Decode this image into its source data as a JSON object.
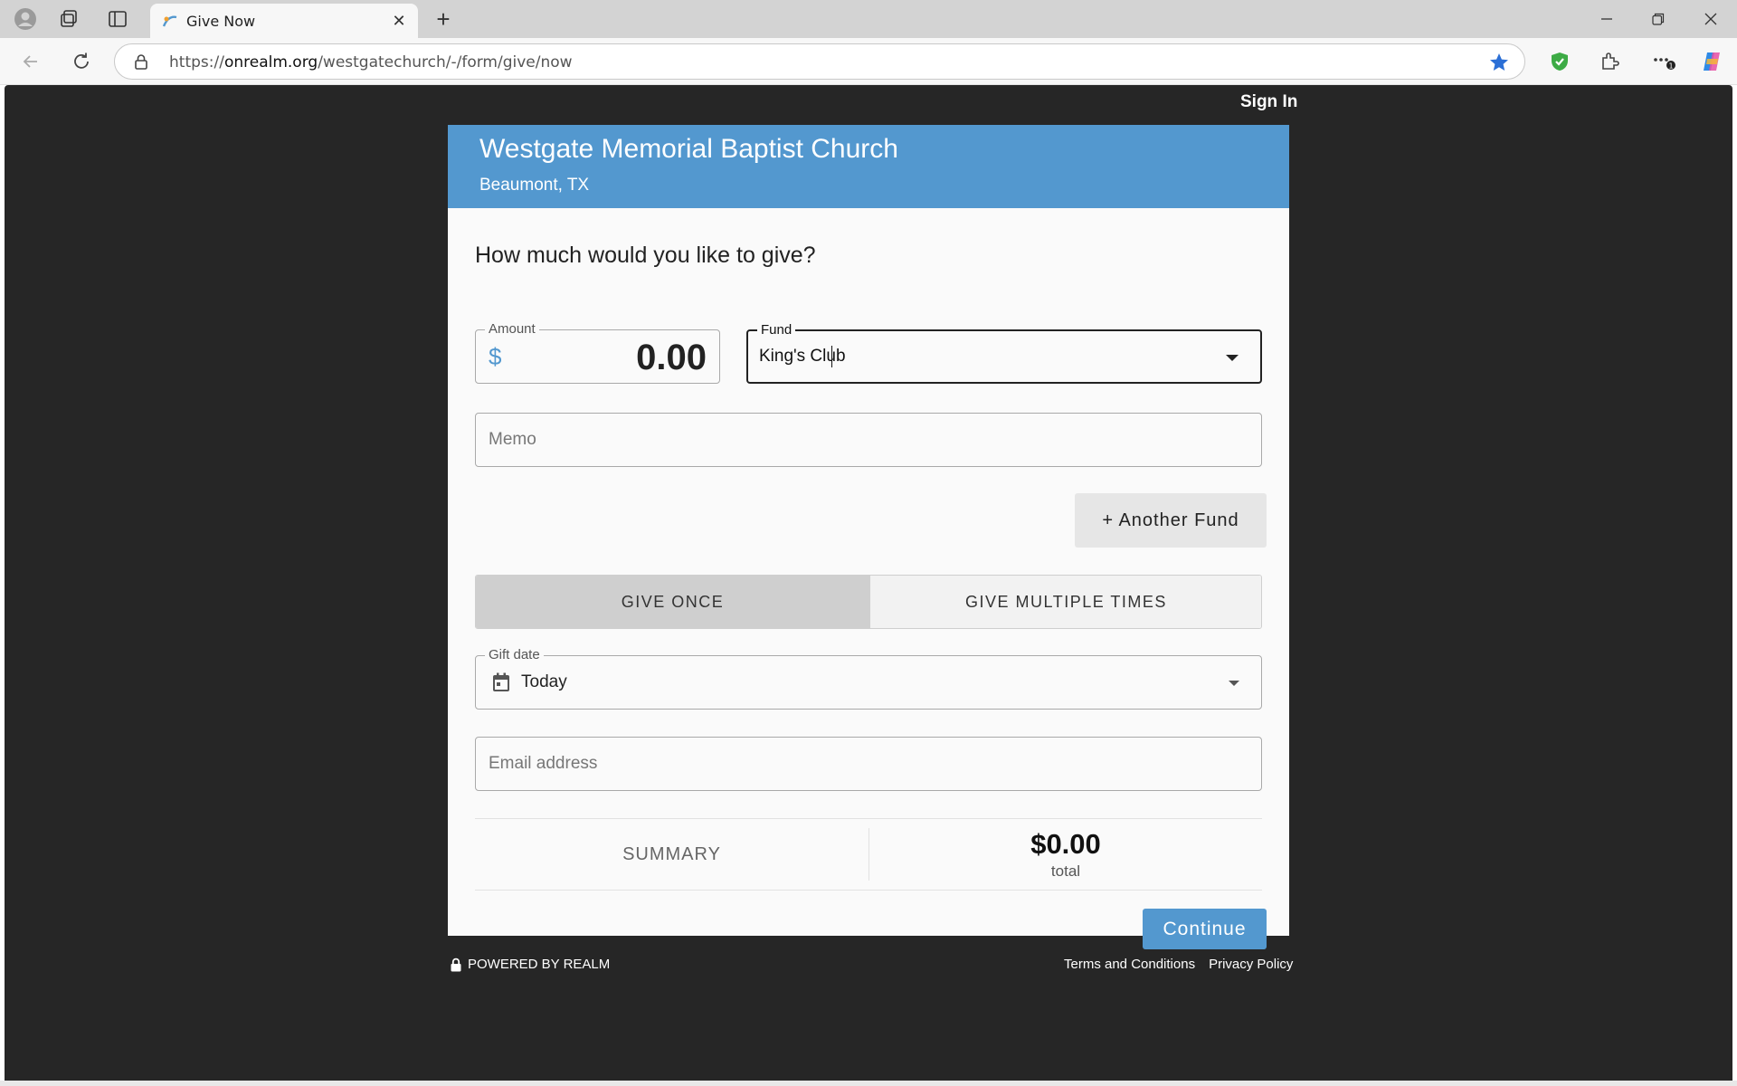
{
  "browser": {
    "tab_title": "Give Now",
    "url_prefix": "https://",
    "url_host": "onrealm.org",
    "url_path": "/westgatechurch/-/form/give/now",
    "icons": [
      "profile-icon",
      "workspaces-icon",
      "tab-actions-icon",
      "back-icon",
      "refresh-icon",
      "lock-icon",
      "favorite-star-icon",
      "shield-extension-icon",
      "extensions-icon",
      "more-icon",
      "copilot-icon",
      "minimize-icon",
      "restore-icon",
      "close-window-icon"
    ]
  },
  "page": {
    "sign_in": "Sign In",
    "church_name": "Westgate Memorial Baptist Church",
    "location": "Beaumont, TX",
    "question": "How much would you like to give?",
    "amount": {
      "label": "Amount",
      "currency": "$",
      "value": "0.00"
    },
    "fund": {
      "label": "Fund",
      "value": "King's Club"
    },
    "memo": {
      "placeholder": "Memo"
    },
    "another_fund": "+ Another Fund",
    "frequency": {
      "once": "GIVE ONCE",
      "multiple": "GIVE MULTIPLE TIMES",
      "selected": "once"
    },
    "gift_date": {
      "label": "Gift date",
      "value": "Today"
    },
    "email": {
      "placeholder": "Email address"
    },
    "summary": {
      "label": "SUMMARY",
      "total": "$0.00",
      "total_label": "total"
    },
    "continue": "Continue"
  },
  "footer": {
    "powered": "POWERED BY REALM",
    "terms": "Terms and Conditions",
    "privacy": "Privacy Policy"
  },
  "colors": {
    "brand_blue": "#5398cf",
    "page_bg": "#262626",
    "card_bg": "#fafafa",
    "toggle_selected": "#cfcfcf"
  }
}
